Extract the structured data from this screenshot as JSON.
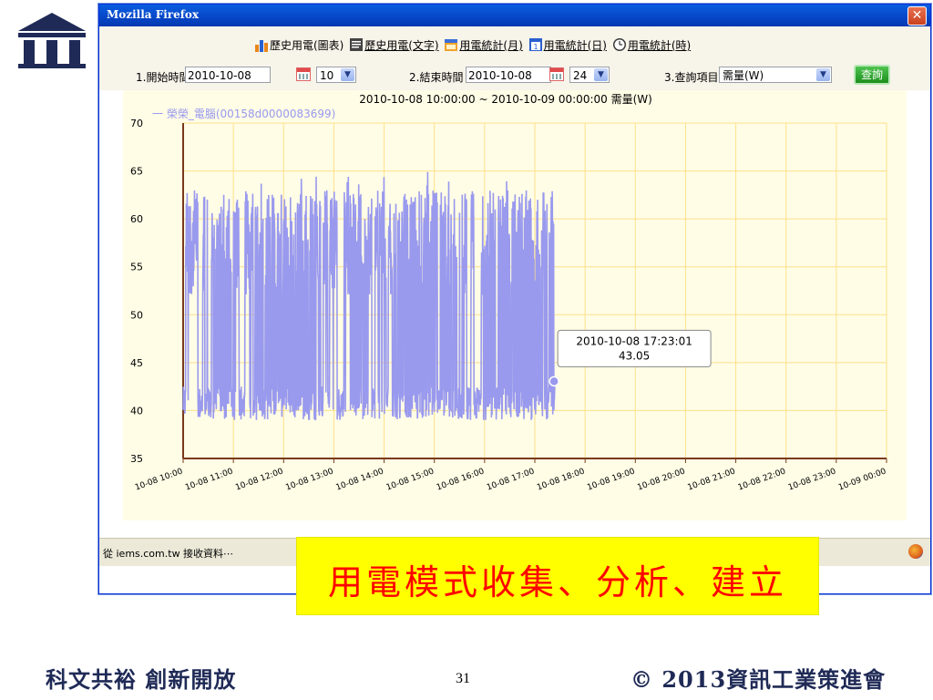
{
  "slide": {
    "footer_left": "科文共裕 創新開放",
    "page_number": "31",
    "footer_right": "© 2013資訊工業策進會",
    "banner_text": "用電模式收集、分析、建立",
    "logo_icon": "pillar-building-icon"
  },
  "window": {
    "title": "Mozilla Firefox",
    "close_label": "✕",
    "status_text": "從 iems.com.tw 接收資料⋯"
  },
  "nav": [
    {
      "label": "歷史用電(圖表)",
      "icon": "bar-chart-icon",
      "underlined": false
    },
    {
      "label": "歷史用電(文字)",
      "icon": "document-icon",
      "underlined": true
    },
    {
      "label": "用電統計(月)",
      "icon": "month-calendar-icon",
      "underlined": true
    },
    {
      "label": "用電統計(日)",
      "icon": "day-calendar-icon",
      "underlined": true
    },
    {
      "label": "用電統計(時)",
      "icon": "clock-icon",
      "underlined": true
    }
  ],
  "query": {
    "start_label": "1.開始時間",
    "start_date": "2010-10-08",
    "start_hour": "10",
    "end_label": "2.結束時間",
    "end_date": "2010-10-08",
    "end_hour": "24",
    "item_label": "3.查詢項目",
    "item_value": "需量(W)",
    "submit_label": "查詢"
  },
  "chart_data": {
    "type": "line",
    "title": "2010-10-08 10:00:00 ~ 2010-10-09 00:00:00 需量(W)",
    "series": [
      {
        "name": "一 榮榮_電腦(00158d0000083699)",
        "color": "#9999ee"
      }
    ],
    "ylim": [
      35,
      70
    ],
    "y_ticks": [
      "35",
      "40",
      "45",
      "50",
      "55",
      "60",
      "65",
      "70"
    ],
    "x_ticks": [
      "10-08 10:00",
      "10-08 11:00",
      "10-08 12:00",
      "10-08 13:00",
      "10-08 14:00",
      "10-08 15:00",
      "10-08 16:00",
      "10-08 17:00",
      "10-08 18:00",
      "10-08 19:00",
      "10-08 20:00",
      "10-08 21:00",
      "10-08 22:00",
      "10-08 23:00",
      "10-09 00:00"
    ],
    "x_range_hours": [
      0,
      14
    ],
    "data_end_hours": 7.4,
    "data_min": 38.5,
    "data_max": 65.3,
    "tooltip": {
      "time": "2010-10-08 17:23:01",
      "value": "43.05",
      "x_hours": 7.383,
      "y": 43.05
    },
    "grid": true,
    "colors": {
      "grid": "#ffe08a",
      "axis": "#7a3a1a",
      "background": "#fffde6"
    }
  }
}
